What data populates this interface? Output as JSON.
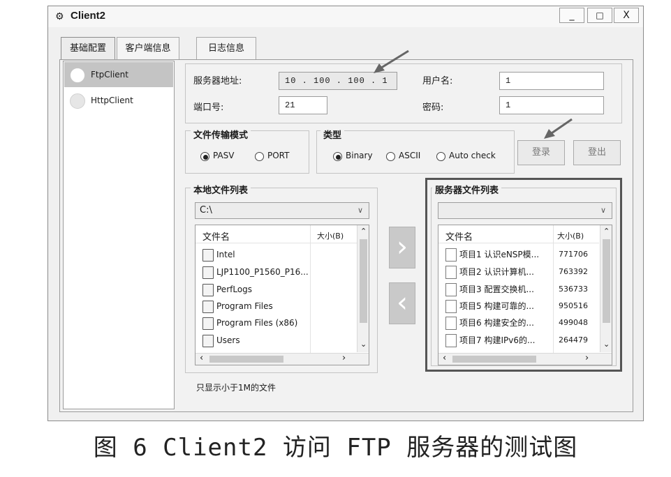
{
  "window": {
    "title": "Client2",
    "minimize": "_",
    "maximize": "□",
    "close": "X"
  },
  "tabs": [
    {
      "label": "基础配置"
    },
    {
      "label": "客户端信息"
    },
    {
      "label": "日志信息"
    }
  ],
  "sidebar": {
    "items": [
      {
        "label": "FtpClient"
      },
      {
        "label": "HttpClient"
      }
    ]
  },
  "server": {
    "address_label": "服务器地址:",
    "address_value": "10 . 100 . 100 . 1",
    "port_label": "端口号:",
    "port_value": "21",
    "user_label": "用户名:",
    "user_value": "1",
    "password_label": "密码:",
    "password_value": "1"
  },
  "transfer_mode": {
    "title": "文件传输模式",
    "options": [
      {
        "label": "PASV",
        "selected": true
      },
      {
        "label": "PORT",
        "selected": false
      }
    ]
  },
  "type": {
    "title": "类型",
    "options": [
      {
        "label": "Binary",
        "selected": true
      },
      {
        "label": "ASCII",
        "selected": false
      },
      {
        "label": "Auto check",
        "selected": false
      }
    ]
  },
  "actions": {
    "login": "登录",
    "logout": "登出"
  },
  "local": {
    "title": "本地文件列表",
    "path": "C:\\",
    "col_name": "文件名",
    "col_size": "大小(B)",
    "files": [
      {
        "name": "Intel",
        "size": ""
      },
      {
        "name": "LJP1100_P1560_P16...",
        "size": ""
      },
      {
        "name": "PerfLogs",
        "size": ""
      },
      {
        "name": "Program Files",
        "size": ""
      },
      {
        "name": "Program Files (x86)",
        "size": ""
      },
      {
        "name": "Users",
        "size": ""
      }
    ]
  },
  "remote": {
    "title": "服务器文件列表",
    "path": "",
    "col_name": "文件名",
    "col_size": "大小(B)",
    "files": [
      {
        "name": "项目1 认识eNSP模...",
        "size": "771706"
      },
      {
        "name": "项目2 认识计算机...",
        "size": "763392"
      },
      {
        "name": "项目3 配置交换机...",
        "size": "536733"
      },
      {
        "name": "项目5 构建可靠的...",
        "size": "950516"
      },
      {
        "name": "项目6 构建安全的...",
        "size": "499048"
      },
      {
        "name": "项目7 构建IPv6的...",
        "size": "264479"
      }
    ]
  },
  "transfer": {
    "upload": "›",
    "download": "‹"
  },
  "filter_note": "只显示小于1M的文件",
  "caption": "图 6  Client2 访问 FTP 服务器的测试图",
  "colors": {
    "window_bg": "#f0f0f0",
    "highlight_border": "#555555",
    "button_text": "#7a7a7a"
  }
}
